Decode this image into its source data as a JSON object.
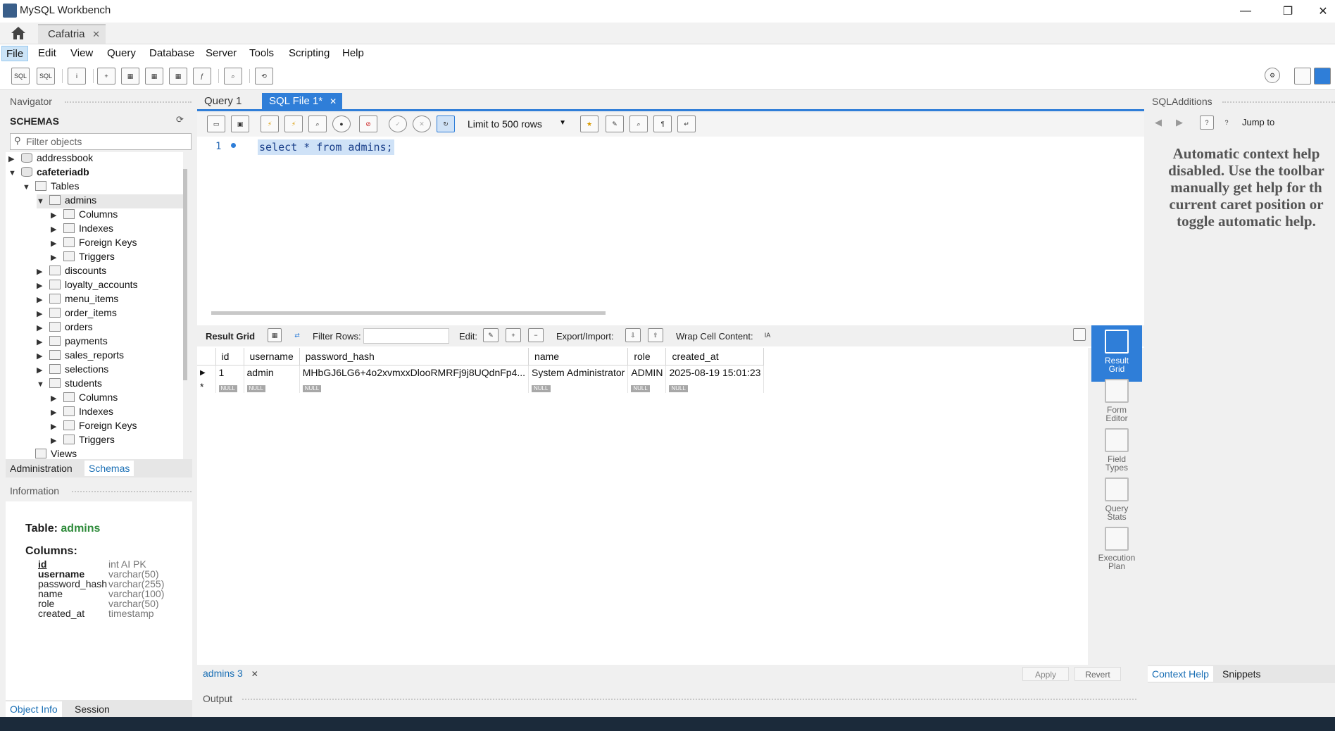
{
  "window": {
    "title": "MySQL Workbench",
    "connection_tab": "Cafatria",
    "controls": {
      "minimize": "—",
      "maximize": "❐",
      "close": "✕"
    }
  },
  "menu": [
    "File",
    "Edit",
    "View",
    "Query",
    "Database",
    "Server",
    "Tools",
    "Scripting",
    "Help"
  ],
  "navigator": {
    "header": "Navigator",
    "schemas_title": "SCHEMAS",
    "filter_placeholder": "Filter objects",
    "tree": [
      {
        "label": "addressbook",
        "level": 0,
        "toggle": "▶",
        "icon": "db"
      },
      {
        "label": "cafeteriadb",
        "level": 0,
        "toggle": "▼",
        "icon": "db",
        "bold": true
      },
      {
        "label": "Tables",
        "level": 1,
        "toggle": "▼",
        "icon": "folder"
      },
      {
        "label": "admins",
        "level": 2,
        "toggle": "▼",
        "icon": "table",
        "selected": true
      },
      {
        "label": "Columns",
        "level": 3,
        "toggle": "▶",
        "icon": "folder"
      },
      {
        "label": "Indexes",
        "level": 3,
        "toggle": "▶",
        "icon": "folder"
      },
      {
        "label": "Foreign Keys",
        "level": 3,
        "toggle": "▶",
        "icon": "folder"
      },
      {
        "label": "Triggers",
        "level": 3,
        "toggle": "▶",
        "icon": "folder"
      },
      {
        "label": "discounts",
        "level": 2,
        "toggle": "▶",
        "icon": "table"
      },
      {
        "label": "loyalty_accounts",
        "level": 2,
        "toggle": "▶",
        "icon": "table"
      },
      {
        "label": "menu_items",
        "level": 2,
        "toggle": "▶",
        "icon": "table"
      },
      {
        "label": "order_items",
        "level": 2,
        "toggle": "▶",
        "icon": "table"
      },
      {
        "label": "orders",
        "level": 2,
        "toggle": "▶",
        "icon": "table"
      },
      {
        "label": "payments",
        "level": 2,
        "toggle": "▶",
        "icon": "table"
      },
      {
        "label": "sales_reports",
        "level": 2,
        "toggle": "▶",
        "icon": "table"
      },
      {
        "label": "selections",
        "level": 2,
        "toggle": "▶",
        "icon": "table"
      },
      {
        "label": "students",
        "level": 2,
        "toggle": "▼",
        "icon": "table"
      },
      {
        "label": "Columns",
        "level": 3,
        "toggle": "▶",
        "icon": "folder"
      },
      {
        "label": "Indexes",
        "level": 3,
        "toggle": "▶",
        "icon": "folder"
      },
      {
        "label": "Foreign Keys",
        "level": 3,
        "toggle": "▶",
        "icon": "folder"
      },
      {
        "label": "Triggers",
        "level": 3,
        "toggle": "▶",
        "icon": "folder"
      },
      {
        "label": "Views",
        "level": 1,
        "toggle": "",
        "icon": "folder"
      }
    ],
    "tabs": [
      "Administration",
      "Schemas"
    ],
    "active_tab": "Schemas"
  },
  "information": {
    "header": "Information",
    "table_prefix": "Table:",
    "table_name": "admins",
    "columns_label": "Columns:",
    "columns": [
      {
        "name": "id",
        "type": "int AI PK",
        "pk": true
      },
      {
        "name": "username",
        "type": "varchar(50)",
        "bold": true
      },
      {
        "name": "password_hash",
        "type": "varchar(255)"
      },
      {
        "name": "name",
        "type": "varchar(100)"
      },
      {
        "name": "role",
        "type": "varchar(50)"
      },
      {
        "name": "created_at",
        "type": "timestamp"
      }
    ],
    "bottom_tabs": [
      "Object Info",
      "Session"
    ]
  },
  "query_tabs": [
    {
      "label": "Query 1",
      "active": false
    },
    {
      "label": "SQL File 1*",
      "active": true
    }
  ],
  "sql_toolbar": {
    "limit": "Limit to 500 rows"
  },
  "editor": {
    "line": "1",
    "code": "select * from admins;"
  },
  "result_toolbar": {
    "result_grid": "Result Grid",
    "filter_rows": "Filter Rows:",
    "edit": "Edit:",
    "export_import": "Export/Import:",
    "wrap": "Wrap Cell Content:"
  },
  "result_grid": {
    "columns": [
      "id",
      "username",
      "password_hash",
      "name",
      "role",
      "created_at"
    ],
    "rows": [
      [
        "1",
        "admin",
        "MHbGJ6LG6+4o2xvmxxDlooRMRFj9j8UQdnFp4...",
        "System Administrator",
        "ADMIN",
        "2025-08-19 15:01:23"
      ]
    ],
    "null_label": "NULL"
  },
  "side_tools": [
    {
      "label": "Result\nGrid",
      "active": true
    },
    {
      "label": "Form\nEditor",
      "active": false
    },
    {
      "label": "Field\nTypes",
      "active": false
    },
    {
      "label": "Query\nStats",
      "active": false
    },
    {
      "label": "Execution\nPlan",
      "active": false
    }
  ],
  "result_tabs": {
    "tab": "admins 3",
    "apply": "Apply",
    "revert": "Revert"
  },
  "output": {
    "label": "Output"
  },
  "sql_additions": {
    "header": "SQLAdditions",
    "jump_to": "Jump to",
    "help_text": "Automatic context help\ndisabled. Use the toolbar\nmanually get help for th\ncurrent caret position or\ntoggle automatic help.",
    "tabs": [
      "Context Help",
      "Snippets"
    ]
  }
}
